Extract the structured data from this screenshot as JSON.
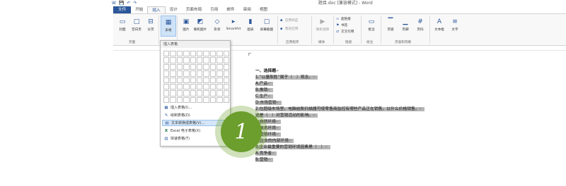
{
  "app": {
    "doc_title": "题目.doc [兼容模式] - Word",
    "quick_access": [
      "W",
      "💾",
      "↶",
      "↷"
    ]
  },
  "tabs": [
    {
      "label": "文件",
      "kind": "file"
    },
    {
      "label": "开始",
      "kind": ""
    },
    {
      "label": "插入",
      "kind": "active"
    },
    {
      "label": "设计",
      "kind": ""
    },
    {
      "label": "页面布局",
      "kind": ""
    },
    {
      "label": "引用",
      "kind": ""
    },
    {
      "label": "邮件",
      "kind": ""
    },
    {
      "label": "审阅",
      "kind": ""
    },
    {
      "label": "视图",
      "kind": ""
    }
  ],
  "ribbon": {
    "cover": "封面",
    "blank_page": "空白页",
    "page_break": "分页",
    "table": "表格",
    "picture": "图片",
    "online_picture": "联机图片",
    "shapes": "形状",
    "smartart": "SmartArt",
    "chart": "图表",
    "screenshot": "屏幕截图",
    "store": "应用商店",
    "my_apps": "我的应用",
    "online_video": "联机视频",
    "hyperlink": "超链接",
    "bookmark": "书签",
    "cross_ref": "交叉引用",
    "comment": "批注",
    "header": "页眉",
    "footer": "页脚",
    "page_number": "页码",
    "textbox": "文本框",
    "text_more": "文字",
    "groups": {
      "pages": "页面",
      "apps": "应用程序",
      "media": "媒体",
      "links": "链接",
      "comments": "批注",
      "header_footer": "页眉和页脚"
    }
  },
  "dropdown": {
    "header": "插入表格",
    "items": [
      {
        "label": "插入表格(I)...",
        "icon": "▦"
      },
      {
        "label": "绘制表格(D)",
        "icon": "✎"
      },
      {
        "label": "文本转换成表格(V)...",
        "icon": "▤"
      },
      {
        "label": "Excel 电子表格(X)",
        "icon": "X"
      },
      {
        "label": "快速表格(T)",
        "icon": "▥"
      }
    ],
    "submenu_arrow": "▸"
  },
  "step_badge": "1",
  "document": {
    "lines": [
      {
        "text": "一、选择题",
        "bold": true,
        "hl": false
      },
      {
        "text": "1.“以量取胜”属于（　）观念。",
        "bold": false,
        "hl": true
      },
      {
        "text": "A.产品",
        "bold": false,
        "hl": true
      },
      {
        "text": "B.推销",
        "bold": false,
        "hl": true
      },
      {
        "text": "C.生产",
        "bold": false,
        "hl": true
      },
      {
        "text": "D.市场营销",
        "bold": false,
        "hl": true
      },
      {
        "text": "2.在超级市场里，电脑结账扫描器可使零售商监控有哪些产品正在销售，以什么价格销售。",
        "bold": false,
        "hl": true
      },
      {
        "text": "这是（　）对营销活动的影响。",
        "bold": false,
        "hl": true
      },
      {
        "text": "A.自然环境",
        "bold": false,
        "hl": true
      },
      {
        "text": "B.技术环境",
        "bold": false,
        "hl": true
      },
      {
        "text": "C.营销环境",
        "bold": false,
        "hl": true
      },
      {
        "text": "D.企业的内部环境",
        "bold": false,
        "hl": true
      },
      {
        "text": "3.企业最重要的营销环境因素是（　）",
        "bold": false,
        "hl": true
      },
      {
        "text": "A.竞争者",
        "bold": false,
        "hl": true
      },
      {
        "text": "B.营销",
        "bold": false,
        "hl": true
      }
    ],
    "para_mark": "↵"
  }
}
